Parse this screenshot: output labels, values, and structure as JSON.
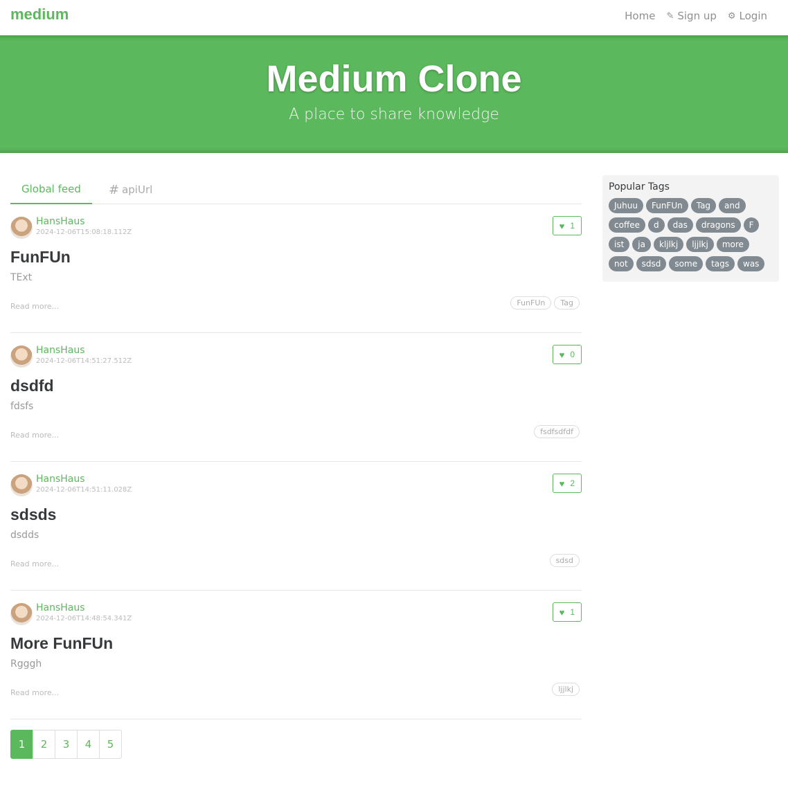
{
  "nav": {
    "brand": "medium",
    "links": [
      {
        "label": "Home",
        "icon": ""
      },
      {
        "label": "Sign up",
        "icon": "compose-icon"
      },
      {
        "label": "Login",
        "icon": "gear-icon"
      }
    ]
  },
  "banner": {
    "title": "Medium Clone",
    "subtitle": "A place to share knowledge"
  },
  "feed": {
    "tabs": [
      {
        "label": "Global feed",
        "active": true
      },
      {
        "label": "apiUrl",
        "active": false
      }
    ]
  },
  "articles": [
    {
      "author": "HansHaus",
      "date": "2024-12-06T15:08:18.112Z",
      "favorites": "1",
      "title": "FunFUn",
      "description": "TExt",
      "read_more": "Read more...",
      "tags": [
        "FunFUn",
        "Tag"
      ]
    },
    {
      "author": "HansHaus",
      "date": "2024-12-06T14:51:27.512Z",
      "favorites": "0",
      "title": "dsdfd",
      "description": "fdsfs",
      "read_more": "Read more...",
      "tags": [
        "fsdfsdfdf"
      ]
    },
    {
      "author": "HansHaus",
      "date": "2024-12-06T14:51:11.028Z",
      "favorites": "2",
      "title": "sdsds",
      "description": "dsdds",
      "read_more": "Read more...",
      "tags": [
        "sdsd"
      ]
    },
    {
      "author": "HansHaus",
      "date": "2024-12-06T14:48:54.341Z",
      "favorites": "1",
      "title": "More FunFUn",
      "description": "Rgggh",
      "read_more": "Read more...",
      "tags": [
        "ljjlkj"
      ]
    }
  ],
  "pagination": {
    "pages": [
      "1",
      "2",
      "3",
      "4",
      "5"
    ],
    "current": "1"
  },
  "sidebar": {
    "title": "Popular Tags",
    "tags": [
      "Juhuu",
      "FunFUn",
      "Tag",
      "and",
      "coffee",
      "d",
      "das",
      "dragons",
      "F",
      "ist",
      "ja",
      "kljlkj",
      "ljjlkj",
      "more",
      "not",
      "sdsd",
      "some",
      "tags",
      "was"
    ]
  },
  "colors": {
    "accent": "#5cb85c",
    "tag_pill": "#818a91"
  }
}
